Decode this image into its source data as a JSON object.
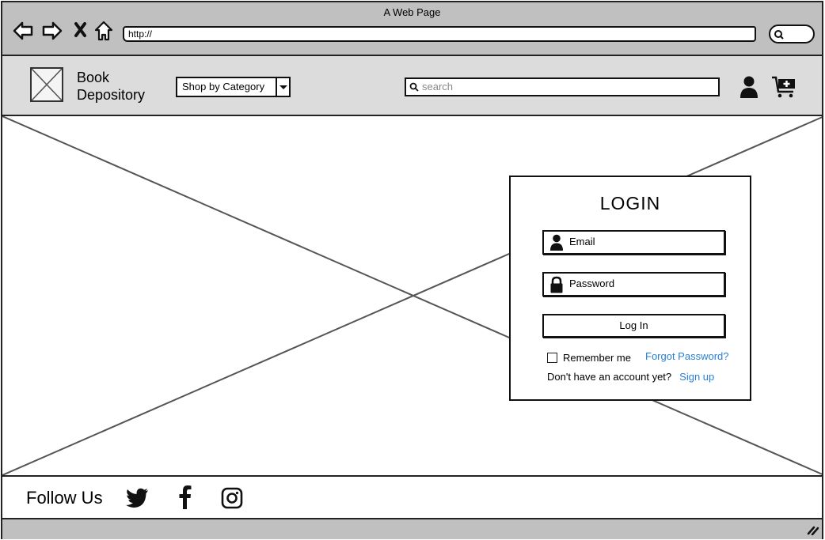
{
  "browser": {
    "title": "A Web Page",
    "url": "http://",
    "icons": [
      "back-arrow-icon",
      "forward-arrow-icon",
      "close-x-icon",
      "home-icon",
      "search-icon"
    ]
  },
  "header": {
    "brand_line1": "Book",
    "brand_line2": "Depository",
    "category_dropdown": "Shop by Category",
    "search_placeholder": "search",
    "icons": [
      "user-icon",
      "cart-add-icon"
    ]
  },
  "login": {
    "title": "LOGIN",
    "email_placeholder": "Email",
    "password_placeholder": "Password",
    "login_button": "Log In",
    "remember_me": "Remember me",
    "remember_checked": false,
    "forgot_password": "Forgot Password?",
    "no_account_text": "Don't have an account yet?",
    "signup_link": "Sign up",
    "link_color": "#2a7fd4"
  },
  "footer": {
    "follow_label": "Follow Us",
    "social_icons": [
      "twitter-icon",
      "facebook-icon",
      "instagram-icon"
    ]
  }
}
